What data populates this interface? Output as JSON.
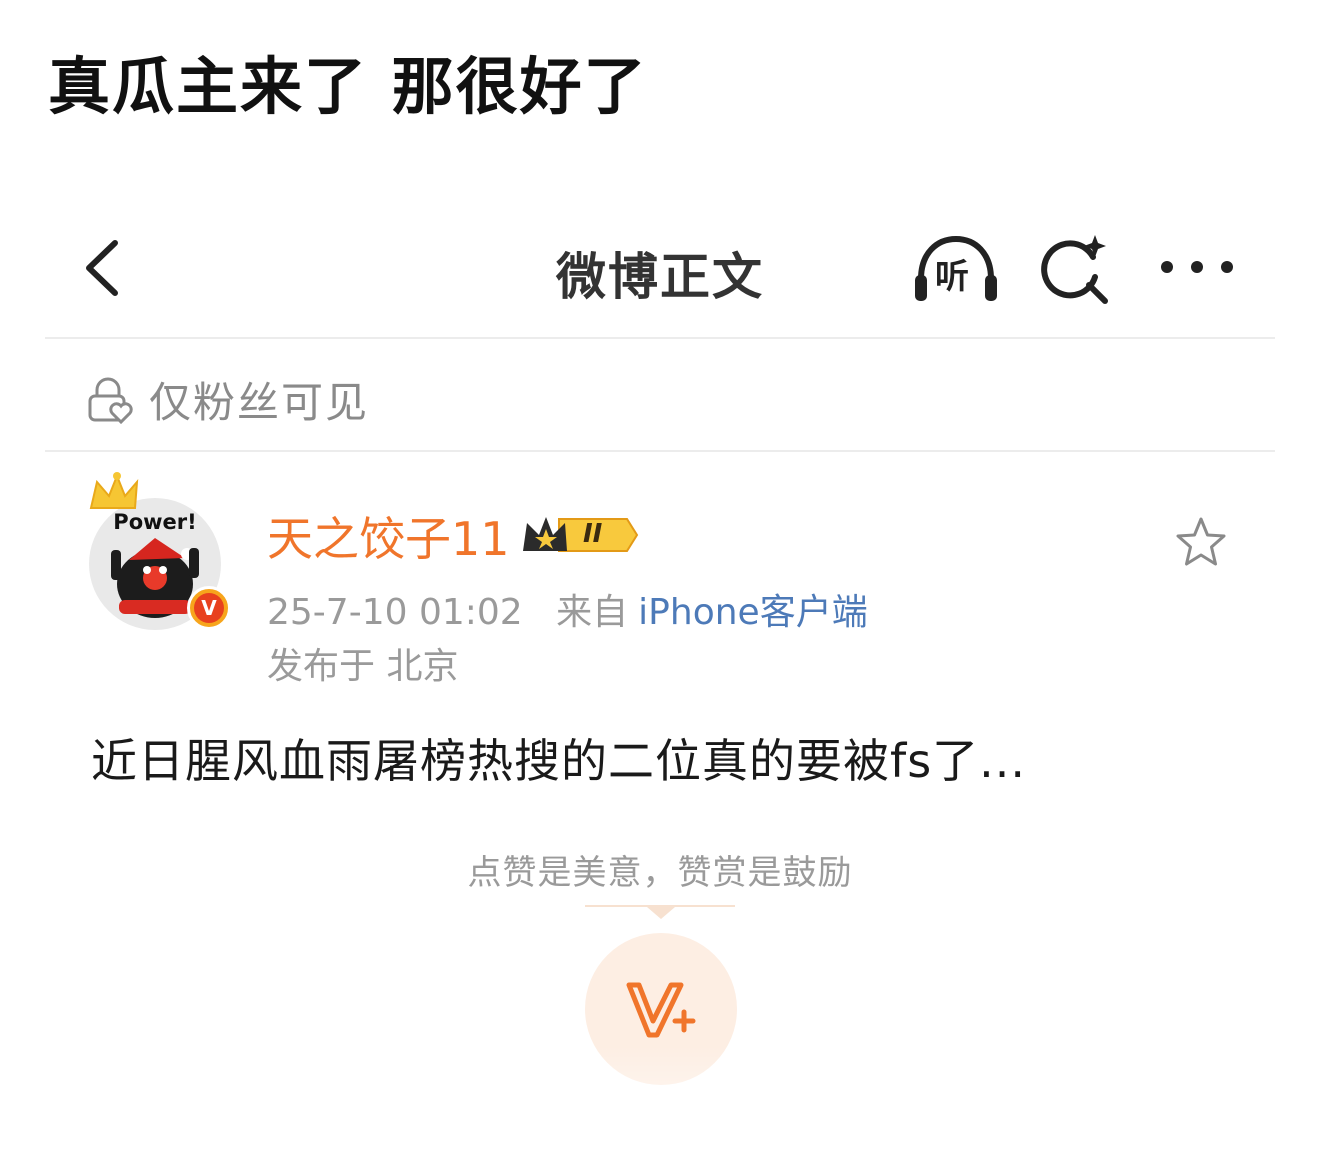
{
  "caption": {
    "text": "真瓜主来了 那很好了"
  },
  "header": {
    "title": "微博正文",
    "back_icon": "chevron-left-icon",
    "listen_label": "听",
    "search_icon": "ai-search-icon",
    "more_icon": "more-dots-icon"
  },
  "visibility": {
    "icon": "lock-heart-icon",
    "text": "仅粉丝可见"
  },
  "author": {
    "avatar_caption": "Power!",
    "verified_mark": "V",
    "name": "天之饺子11",
    "member_level": "II"
  },
  "post": {
    "time": "25-7-10 01:02",
    "source_prefix": "来自",
    "source": "iPhone客户端",
    "location": "发布于 北京",
    "text": "近日腥风血雨屠榜热搜的二位真的要被fs了..."
  },
  "reward": {
    "hint": "点赞是美意，赞赏是鼓励",
    "icon": "v-plus-icon"
  },
  "colors": {
    "accent": "#f0752b",
    "link": "#4d7ab8",
    "muted": "#9a9a9a",
    "reward_bg": "#fdeee3"
  }
}
